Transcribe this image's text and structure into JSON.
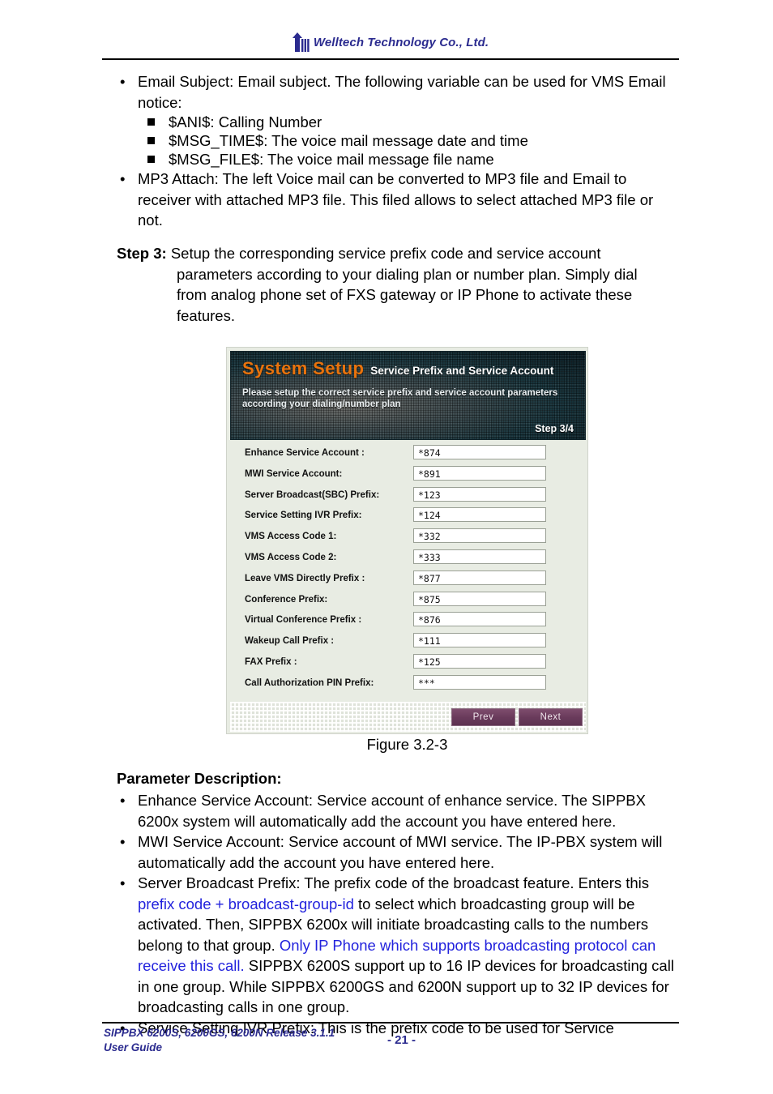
{
  "header": {
    "company": "Welltech Technology Co., Ltd.",
    "logo_icon": "welltech-arrow-logo"
  },
  "body": {
    "bullets": [
      {
        "text": "Email Subject: Email subject. The following variable can be used for VMS Email notice:",
        "sub_items": [
          "$ANI$: Calling Number",
          "$MSG_TIME$: The voice mail message date and time",
          "$MSG_FILE$: The voice mail message file name"
        ]
      },
      {
        "text": "MP3 Attach: The left Voice mail can be converted to MP3 file and Email to receiver with attached MP3 file. This filed allows to select attached MP3 file or not.",
        "sub_items": []
      }
    ],
    "step": {
      "label": "Step 3:",
      "line1": " Setup the corresponding service prefix code and service account",
      "line2": "parameters according to your dialing plan or number plan. Simply dial",
      "line3": "from analog phone set of FXS gateway or IP Phone to activate these",
      "line4": "features."
    }
  },
  "screenshot": {
    "banner": {
      "title": "System Setup",
      "subtitle": "Service Prefix and Service Account",
      "description": "Please setup the correct service prefix and service account parameters according your dialing/number plan",
      "step_indicator": "Step 3/4",
      "title_color": "#e8730d"
    },
    "fields": [
      {
        "label": "Enhance Service Account :",
        "value": "*874"
      },
      {
        "label": "MWI Service Account:",
        "value": "*891"
      },
      {
        "label": "Server Broadcast(SBC) Prefix:",
        "value": "*123"
      },
      {
        "label": "Service Setting IVR Prefix:",
        "value": "*124"
      },
      {
        "label": "VMS Access Code 1:",
        "value": "*332"
      },
      {
        "label": "VMS Access Code 2:",
        "value": "*333"
      },
      {
        "label": "Leave VMS Directly Prefix :",
        "value": "*877"
      },
      {
        "label": "Conference Prefix:",
        "value": "*875"
      },
      {
        "label": "Virtual Conference Prefix :",
        "value": "*876"
      },
      {
        "label": "Wakeup Call Prefix :",
        "value": "*111"
      },
      {
        "label": "FAX Prefix :",
        "value": "*125"
      },
      {
        "label": "Call Authorization PIN Prefix:",
        "value": "***"
      }
    ],
    "buttons": {
      "prev": "Prev",
      "next": "Next",
      "color": "#6a3b5c"
    }
  },
  "figure_caption": "Figure 3.2-3",
  "params": {
    "heading": "Parameter Description:",
    "items": [
      {
        "segments": [
          {
            "text": "Enhance Service Account: Service account of enhance service. The SIPPBX 6200x system will automatically add the account you have entered here.",
            "color": "black"
          }
        ]
      },
      {
        "segments": [
          {
            "text": "MWI Service Account: Service account of MWI service. The IP-PBX system will automatically add the account you have entered here.",
            "color": "black"
          }
        ]
      },
      {
        "segments": [
          {
            "text": "Server Broadcast Prefix: The prefix code of the broadcast feature. Enters this ",
            "color": "black"
          },
          {
            "text": "prefix code + broadcast-group-id",
            "color": "blue"
          },
          {
            "text": " to select which broadcasting group will be activated. Then, SIPPBX 6200x will initiate broadcasting calls to the numbers belong to that group. ",
            "color": "black"
          },
          {
            "text": "Only IP Phone which supports broadcasting protocol can receive this call.",
            "color": "blue"
          },
          {
            "text": " SIPPBX 6200S support up to 16 IP devices for broadcasting call in one group. While SIPPBX 6200GS and 6200N support up to 32 IP devices for broadcasting calls in one group.",
            "color": "black"
          }
        ]
      },
      {
        "segments": [
          {
            "text": "Service Setting IVR Prefix: This is the prefix code to be used for Service",
            "color": "black"
          }
        ]
      }
    ]
  },
  "footer": {
    "line1": "SIPPBX 6200S, 6200GS, 6200N    Release 3.1.1",
    "line2": "User Guide",
    "page": "- 21 -"
  }
}
